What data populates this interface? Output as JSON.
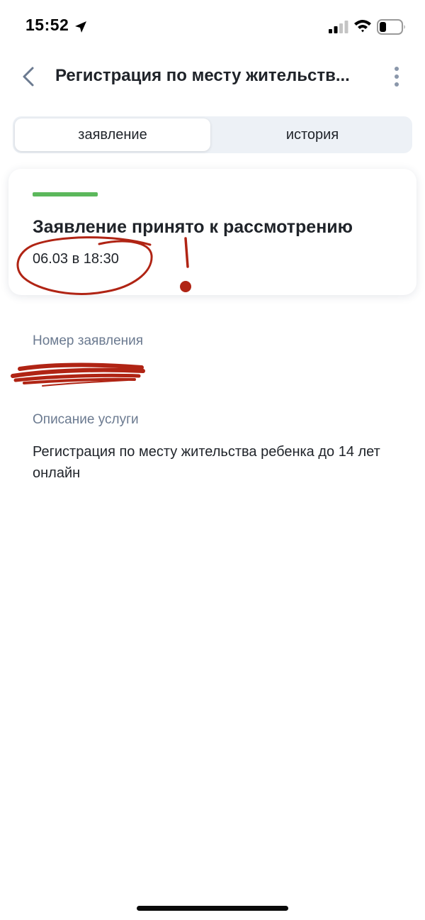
{
  "status_bar": {
    "time": "15:52",
    "icons": [
      "location-arrow-icon",
      "cellular-signal-icon",
      "wifi-icon",
      "battery-icon"
    ]
  },
  "nav": {
    "back_icon": "chevron-left-icon",
    "title": "Регистрация по месту жительств...",
    "more_icon": "vertical-dots-icon"
  },
  "tabs": [
    {
      "label": "заявление",
      "active": true
    },
    {
      "label": "история",
      "active": false
    }
  ],
  "status_card": {
    "progress": 1.0,
    "progress_color": "#5cb85c",
    "title": "Заявление принято к рассмотрению",
    "date": "06.03 в 18:30"
  },
  "annotation": {
    "color": "#b02414",
    "marks": [
      "circle-around-date",
      "exclamation-mark",
      "scribble-redaction"
    ]
  },
  "fields": [
    {
      "label": "Номер заявления",
      "value": ""
    },
    {
      "label": "Описание услуги",
      "value": "Регистрация по месту жительства ребенка до 14 лет онлайн"
    }
  ],
  "colors": {
    "accent_green": "#5cb85c",
    "label_gray": "#6b7a90",
    "text_dark": "#1f2329",
    "segment_bg": "#edf1f6"
  }
}
